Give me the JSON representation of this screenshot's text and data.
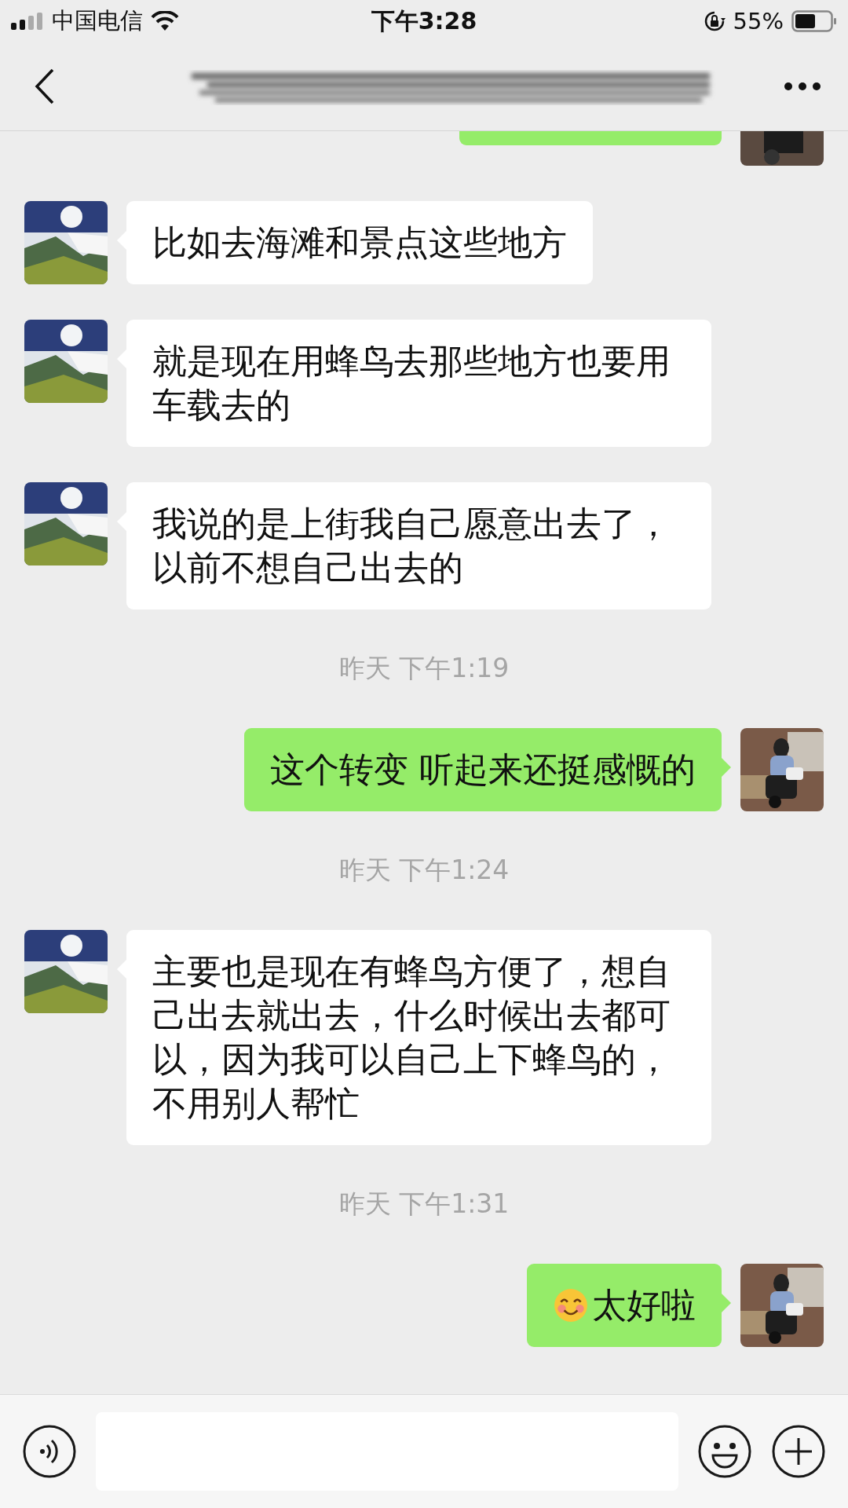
{
  "status_bar": {
    "carrier": "中国电信",
    "time": "下午3:28",
    "battery": "55%"
  },
  "messages": [
    {
      "kind": "cut_out"
    },
    {
      "kind": "in",
      "text": "比如去海滩和景点这些地方"
    },
    {
      "kind": "in",
      "text": "就是现在用蜂鸟去那些地方也要用车载去的"
    },
    {
      "kind": "in",
      "text": "我说的是上街我自己愿意出去了，以前不想自己出去的"
    },
    {
      "kind": "time",
      "text": "昨天 下午1:19"
    },
    {
      "kind": "out",
      "text": "这个转变 听起来还挺感慨的"
    },
    {
      "kind": "time",
      "text": "昨天 下午1:24"
    },
    {
      "kind": "in",
      "text": "主要也是现在有蜂鸟方便了，想自己出去就出去，什么时候出去都可以，因为我可以自己上下蜂鸟的，不用别人帮忙"
    },
    {
      "kind": "time",
      "text": "昨天 下午1:31"
    },
    {
      "kind": "out",
      "emoji": true,
      "text": "太好啦"
    }
  ]
}
